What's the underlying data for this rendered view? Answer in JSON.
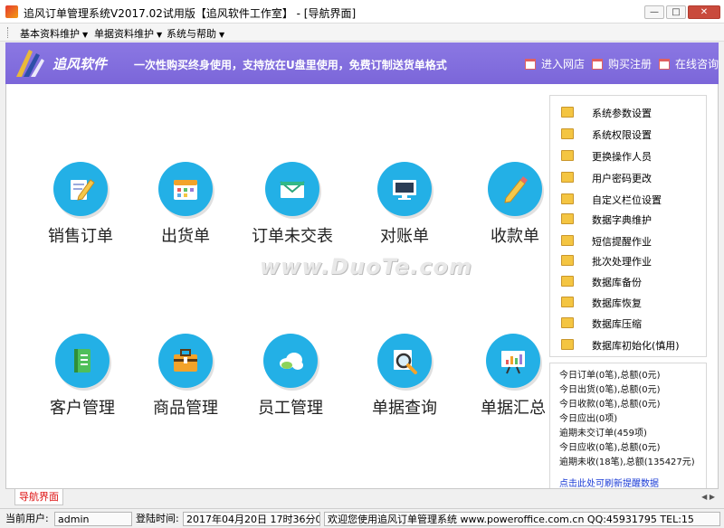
{
  "window": {
    "title": "追风订单管理系统V2017.02试用版【追风软件工作室】 - [导航界面]",
    "minimize_glyph": "—",
    "restore_glyph": "□",
    "close_glyph": "✕"
  },
  "menu": [
    {
      "label": "基本资料维护"
    },
    {
      "label": "单据资料维护"
    },
    {
      "label": "系统与帮助"
    }
  ],
  "banner": {
    "logo_text": "追风软件",
    "slogan": "一次性购买终身使用，支持放在U盘里使用，免费订制送货单格式",
    "links": [
      {
        "label": "进入网店",
        "icon": "calendar-icon"
      },
      {
        "label": "购买注册",
        "icon": "calendar-icon"
      },
      {
        "label": "在线咨询",
        "icon": "calendar-icon"
      }
    ]
  },
  "tiles": [
    {
      "label": "销售订单",
      "icon": "pencil-note-icon"
    },
    {
      "label": "出货单",
      "icon": "calendar-icon"
    },
    {
      "label": "订单未交表",
      "icon": "envelope-icon"
    },
    {
      "label": "对账单",
      "icon": "monitor-icon"
    },
    {
      "label": "收款单",
      "icon": "pencil-icon"
    },
    {
      "label": "客户管理",
      "icon": "book-icon"
    },
    {
      "label": "商品管理",
      "icon": "briefcase-icon"
    },
    {
      "label": "员工管理",
      "icon": "cloud-icon"
    },
    {
      "label": "单据查询",
      "icon": "magnifier-icon"
    },
    {
      "label": "单据汇总",
      "icon": "presentation-chart-icon"
    }
  ],
  "watermark": "www.DuoTe.com",
  "system_menu": [
    "系统参数设置",
    "系统权限设置",
    "更换操作人员",
    "用户密码更改",
    "自定义栏位设置",
    "数据字典维护",
    "短信提醒作业",
    "批次处理作业",
    "数据库备份",
    "数据库恢复",
    "数据库压缩",
    "数据库初始化(慎用)"
  ],
  "stats": [
    "今日订单(0笔),总额(0元)",
    "今日出货(0笔),总额(0元)",
    "今日收款(0笔),总额(0元)",
    "今日应出(0项)",
    "逾期未交订单(459项)",
    "今日应收(0笔),总额(0元)",
    "逾期未收(18笔),总额(135427元)"
  ],
  "stats_link": "点击此处可刷新提醒数据",
  "tab": {
    "label": "导航界面"
  },
  "status": {
    "user_label": "当前用户:",
    "user_value": "admin",
    "login_label": "登陆时间:",
    "login_value": "2017年04月20日 17时36分02秒",
    "welcome": "欢迎您使用追风订单管理系统 www.poweroffice.com.cn  QQ:45931795 TEL:15"
  }
}
